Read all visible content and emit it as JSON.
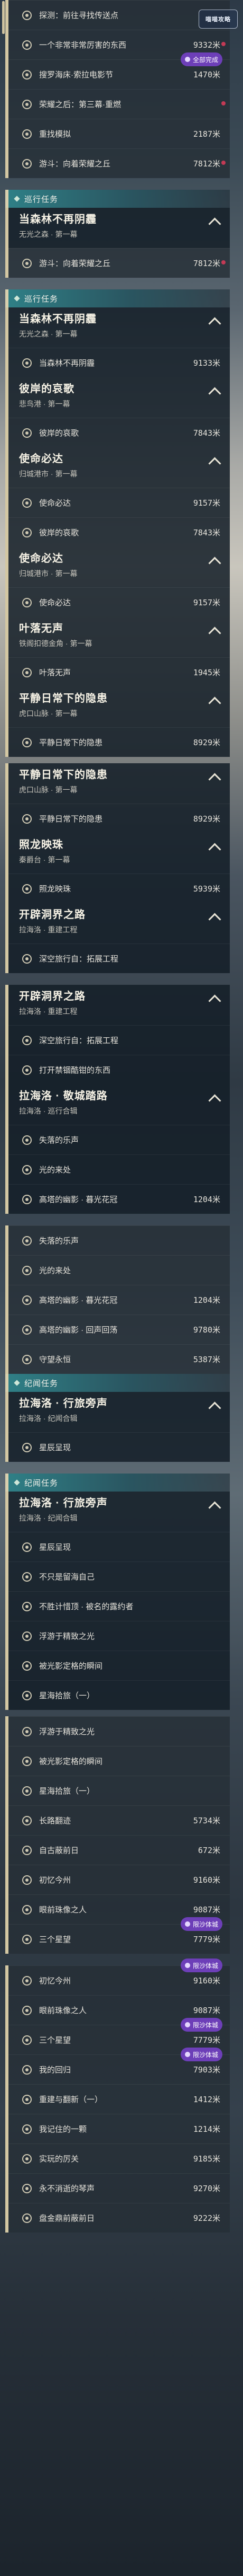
{
  "watermark": "喵喵攻略",
  "blocks": [
    {
      "t": "row",
      "label": "探测：前往寻找传送点",
      "dist": "",
      "dim": true
    },
    {
      "t": "row",
      "label": "一个非常非常厉害的东西",
      "dist": "9332米",
      "dim": true,
      "pin": true
    },
    {
      "t": "row",
      "label": "搜罗海床·索拉电影节",
      "dist": "1470米",
      "dim": true,
      "tag": "全部完成"
    },
    {
      "t": "row",
      "label": "荣耀之后：第三幕·重燃",
      "dist": "",
      "dim": true,
      "pin": true
    },
    {
      "t": "row",
      "label": "重找模拟",
      "dist": "2187米",
      "dim": true
    },
    {
      "t": "row",
      "label": "游斗：向着荣耀之丘",
      "dist": "7812米",
      "dim": true,
      "pin": true
    },
    {
      "t": "gap"
    },
    {
      "t": "sec",
      "label": "巡行任务"
    },
    {
      "t": "card",
      "title": "当森林不再阴霾",
      "sub": "无光之森 · 第一幕",
      "chev": "down"
    },
    {
      "t": "row",
      "label": "游斗：向着荣耀之丘",
      "dist": "7812米",
      "dim": true,
      "pin": true
    },
    {
      "t": "gap"
    },
    {
      "t": "sec",
      "label": "巡行任务"
    },
    {
      "t": "card",
      "title": "当森林不再阴霾",
      "sub": "无光之森 · 第一幕",
      "chev": "up"
    },
    {
      "t": "row",
      "label": "当森林不再阴霾",
      "dist": "9133米"
    },
    {
      "t": "card",
      "title": "彼岸的哀歌",
      "sub": "悲鸟港 · 第一幕",
      "chev": "up"
    },
    {
      "t": "row",
      "label": "彼岸的哀歌",
      "dist": "7843米"
    },
    {
      "t": "card",
      "title": "使命必达",
      "sub": "归城港市 · 第一幕",
      "chev": "up"
    },
    {
      "t": "row",
      "label": "使命必达",
      "dist": "9157米"
    },
    {
      "t": "row",
      "label": "彼岸的哀歌",
      "dist": "7843米"
    },
    {
      "t": "card",
      "title": "使命必达",
      "sub": "归城港市 · 第一幕",
      "chev": "up"
    },
    {
      "t": "row",
      "label": "使命必达",
      "dist": "9157米"
    },
    {
      "t": "card",
      "title": "叶落无声",
      "sub": "铁阁扣德金角 · 第一幕",
      "chev": "up"
    },
    {
      "t": "row",
      "label": "叶落无声",
      "dist": "1945米"
    },
    {
      "t": "card",
      "title": "平静日常下的隐患",
      "sub": "虎口山脉 · 第一幕",
      "chev": "up"
    },
    {
      "t": "row",
      "label": "平静日常下的隐患",
      "dist": "8929米"
    },
    {
      "t": "gap",
      "s": true
    },
    {
      "t": "card",
      "title": "平静日常下的隐患",
      "sub": "虎口山脉 · 第一幕",
      "chev": "up"
    },
    {
      "t": "row",
      "label": "平静日常下的隐患",
      "dist": "8929米"
    },
    {
      "t": "card",
      "title": "照龙映珠",
      "sub": "秦爵台 · 第一幕",
      "chev": "up"
    },
    {
      "t": "row",
      "label": "照龙映珠",
      "dist": "5939米"
    },
    {
      "t": "card",
      "title": "开辟洞界之路",
      "sub": "拉海洛 · 重建工程",
      "chev": "up"
    },
    {
      "t": "row",
      "label": "深空旅行自：拓展工程",
      "dist": ""
    },
    {
      "t": "gap"
    },
    {
      "t": "card",
      "title": "开辟洞界之路",
      "sub": "拉海洛 · 重建工程",
      "chev": "up"
    },
    {
      "t": "row",
      "label": "深空旅行自：拓展工程",
      "dist": ""
    },
    {
      "t": "row",
      "label": "打开禁锢酷钳的东西",
      "dist": ""
    },
    {
      "t": "card",
      "title": "拉海洛 · 敬城踏路",
      "sub": "拉海洛 · 巡行合辑",
      "chev": "up"
    },
    {
      "t": "row",
      "label": "失落的乐声",
      "dist": ""
    },
    {
      "t": "row",
      "label": "光的来处",
      "dist": ""
    },
    {
      "t": "row",
      "label": "高塔的幽影 · 暮光花冠",
      "dist": "1204米"
    },
    {
      "t": "gap"
    },
    {
      "t": "row",
      "label": "失落的乐声",
      "dist": ""
    },
    {
      "t": "row",
      "label": "光的来处",
      "dist": ""
    },
    {
      "t": "row",
      "label": "高塔的幽影 · 暮光花冠",
      "dist": "1204米"
    },
    {
      "t": "row",
      "label": "高塔的幽影 · 回声回荡",
      "dist": "9780米"
    },
    {
      "t": "row",
      "label": "守望永恒",
      "dist": "5387米"
    },
    {
      "t": "sec",
      "label": "纪闻任务"
    },
    {
      "t": "card",
      "title": "拉海洛 · 行旅旁声",
      "sub": "拉海洛 · 纪闻合辑",
      "chev": "up"
    },
    {
      "t": "row",
      "label": "星辰呈现",
      "dist": ""
    },
    {
      "t": "gap"
    },
    {
      "t": "sec",
      "label": "纪闻任务"
    },
    {
      "t": "card",
      "title": "拉海洛 · 行旅旁声",
      "sub": "拉海洛 · 纪闻合辑",
      "chev": "up"
    },
    {
      "t": "row",
      "label": "星辰呈现",
      "dist": ""
    },
    {
      "t": "row",
      "label": "不只是留海自己",
      "dist": ""
    },
    {
      "t": "row",
      "label": "不胜计惜顶 · 被名的露约者",
      "dist": ""
    },
    {
      "t": "row",
      "label": "浮游于精致之光",
      "dist": ""
    },
    {
      "t": "row",
      "label": "被光影定格的瞬间",
      "dist": ""
    },
    {
      "t": "row",
      "label": "星海拾旅（一）",
      "dist": ""
    },
    {
      "t": "gap",
      "s": true
    },
    {
      "t": "row",
      "label": "浮游于精致之光",
      "dist": ""
    },
    {
      "t": "row",
      "label": "被光影定格的瞬间",
      "dist": ""
    },
    {
      "t": "row",
      "label": "星海拾旅（一）",
      "dist": ""
    },
    {
      "t": "row",
      "label": "长路翻迹",
      "dist": "5734米"
    },
    {
      "t": "row",
      "label": "自古蔽前日",
      "dist": "672米"
    },
    {
      "t": "row",
      "label": "初忆今州",
      "dist": "9160米"
    },
    {
      "t": "row",
      "label": "眼前珠像之人",
      "dist": "9087米"
    },
    {
      "t": "row",
      "label": "三个星望",
      "dist": "7779米",
      "tag": "限沙体城"
    },
    {
      "t": "gap"
    },
    {
      "t": "row",
      "label": "初忆今州",
      "dist": "9160米",
      "tag": "限沙体城"
    },
    {
      "t": "row",
      "label": "眼前珠像之人",
      "dist": "9087米"
    },
    {
      "t": "row",
      "label": "三个星望",
      "dist": "7779米",
      "tag": "限沙体城"
    },
    {
      "t": "row",
      "label": "我的回归",
      "dist": "7903米",
      "tag": "限沙体城"
    },
    {
      "t": "row",
      "label": "重建与翻新（一）",
      "dist": "1412米"
    },
    {
      "t": "row",
      "label": "我记住的一颗",
      "dist": "1214米"
    },
    {
      "t": "row",
      "label": "实玩的厉关",
      "dist": "9185米"
    },
    {
      "t": "row",
      "label": "永不消逝的琴声",
      "dist": "9270米"
    },
    {
      "t": "row",
      "label": "盘金鼎前蔽前日",
      "dist": "9222米"
    }
  ]
}
